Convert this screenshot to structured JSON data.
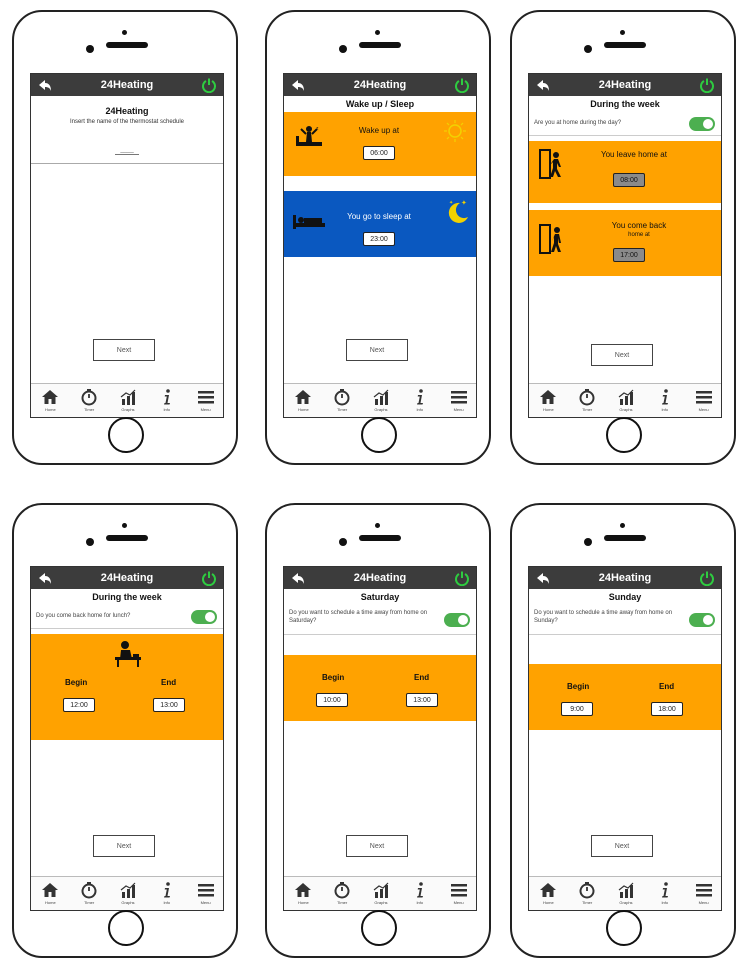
{
  "app_title": "24Heating",
  "tabs": [
    {
      "label": "Home",
      "icon": "home-icon"
    },
    {
      "label": "Timer",
      "icon": "timer-icon"
    },
    {
      "label": "Graphs",
      "icon": "graph-icon"
    },
    {
      "label": "Info",
      "icon": "info-icon"
    },
    {
      "label": "Menu",
      "icon": "menu-icon"
    }
  ],
  "next_label": "Next",
  "colors": {
    "header": "#3c3c3c",
    "orange": "#ffa200",
    "blue": "#0a58c0",
    "toggle_on": "#4caf50",
    "power": "#2ecc40"
  },
  "screen1": {
    "title": "24Heating",
    "subtitle": "Insert the name of the thermostat schedule",
    "input_placeholder": "____"
  },
  "screen2": {
    "section": "Wake up / Sleep",
    "wake_label": "Wake up at",
    "wake_time": "06:00",
    "sleep_label": "You go to sleep at",
    "sleep_time": "23:00"
  },
  "screen3": {
    "section": "During the week",
    "toggle_text": "Are you at home during the day?",
    "leave_label": "You leave home at",
    "leave_time": "08:00",
    "back_label_1": "You come back",
    "back_label_2": "home at",
    "back_time": "17:00"
  },
  "screen4": {
    "section": "During the week",
    "toggle_text": "Do you come back home for lunch?",
    "begin_label": "Begin",
    "end_label": "End",
    "begin_time": "12:00",
    "end_time": "13:00"
  },
  "screen5": {
    "section": "Saturday",
    "toggle_text": "Do you want to schedule a time away from home on Saturday?",
    "begin_label": "Begin",
    "end_label": "End",
    "begin_time": "10:00",
    "end_time": "13:00"
  },
  "screen6": {
    "section": "Sunday",
    "toggle_text": "Do you want to schedule a time away from home on Sunday?",
    "begin_label": "Begin",
    "end_label": "End",
    "begin_time": "9:00",
    "end_time": "18:00"
  }
}
